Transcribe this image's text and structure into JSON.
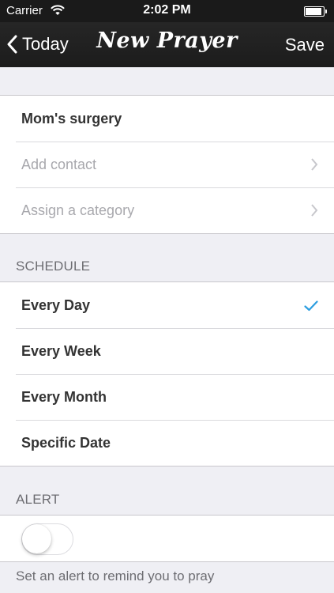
{
  "status_bar": {
    "carrier": "Carrier",
    "time": "2:02 PM",
    "battery_level": 1.0
  },
  "nav": {
    "back_label": "Today",
    "title": "New Prayer",
    "save_label": "Save"
  },
  "prayer": {
    "title_value": "Mom's surgery",
    "contact_placeholder": "Add contact",
    "category_placeholder": "Assign a category"
  },
  "schedule": {
    "header": "SCHEDULE",
    "options": [
      "Every Day",
      "Every Week",
      "Every Month",
      "Specific Date"
    ],
    "selected": "Every Day"
  },
  "alert": {
    "header": "ALERT",
    "enabled": false,
    "description": "Set an alert to remind you to pray"
  },
  "colors": {
    "accent": "#2d9ee0",
    "nav_background": "#1f1f1f",
    "page_background": "#efeff4"
  }
}
